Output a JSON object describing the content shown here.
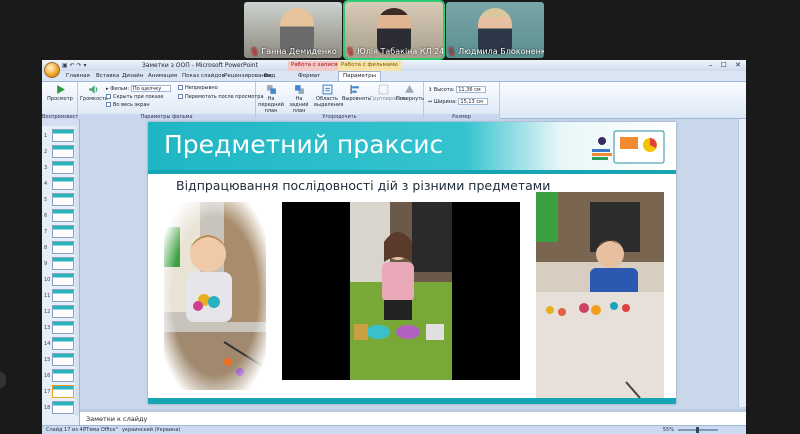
{
  "participants": [
    {
      "name": "Ганна Демиденко",
      "active": false
    },
    {
      "name": "Юлія Табакіна КЛ 24",
      "active": true
    },
    {
      "name": "Людмила Блоконенко",
      "active": false
    }
  ],
  "window": {
    "title": "Заметки з ООП - Microsoft PowerPoint",
    "context_tab_recording": "Работа с записями",
    "context_tab_picture": "Работа с фильмами",
    "controls": "– ☐ ✕"
  },
  "qat": "▣ ↶ ↷ ▾",
  "tabs": [
    {
      "label": "Главная"
    },
    {
      "label": "Вставка"
    },
    {
      "label": "Дизайн"
    },
    {
      "label": "Анимация"
    },
    {
      "label": "Показ слайдов"
    },
    {
      "label": "Рецензирование"
    },
    {
      "label": "Вид"
    },
    {
      "label": "Формат"
    },
    {
      "label": "Параметры"
    }
  ],
  "ribbon": {
    "preview_label": "Просмотр",
    "volume_label": "Громкость",
    "play_label": "Фильм:",
    "play_option": "По щелчку",
    "hide_label": "Скрыть при показе",
    "fullscreen_label": "Во весь экран",
    "loop_label": "Непрерывно",
    "rewind_label": "Перемотать после просмотра",
    "front_label": "На передний план",
    "back_label": "На задний план",
    "selpane_label": "Область выделения",
    "align_label": "Выровнять",
    "group_label": "Группировать",
    "rotate_label": "Повернуть",
    "height_label": "Высота:",
    "height_value": "11,36 см",
    "width_label": "Ширина:",
    "width_value": "15,13 см",
    "group_play": "Воспроизвести",
    "group_options": "Параметры фильма",
    "group_arrange": "Упорядочить",
    "group_size": "Размер"
  },
  "thumbnails": [
    "1",
    "2",
    "3",
    "4",
    "5",
    "6",
    "7",
    "8",
    "9",
    "10",
    "11",
    "12",
    "13",
    "14",
    "15",
    "16",
    "17",
    "18"
  ],
  "current_thumbnail": 17,
  "slide": {
    "title": "Предметний праксис",
    "subtitle": "Відпрацювання послідовності дій з різними предметами"
  },
  "notes": {
    "label": "Заметки к слайду"
  },
  "status": {
    "slide_info": "Слайд 17 из 40",
    "theme": "\"Тема Office\"",
    "language": "украинский (Украина)",
    "zoom": "55%"
  },
  "colors": {
    "accent": "#1fb6c4",
    "ribbon_bg": "#dbe6f4",
    "active_speaker": "#2ecc71"
  }
}
